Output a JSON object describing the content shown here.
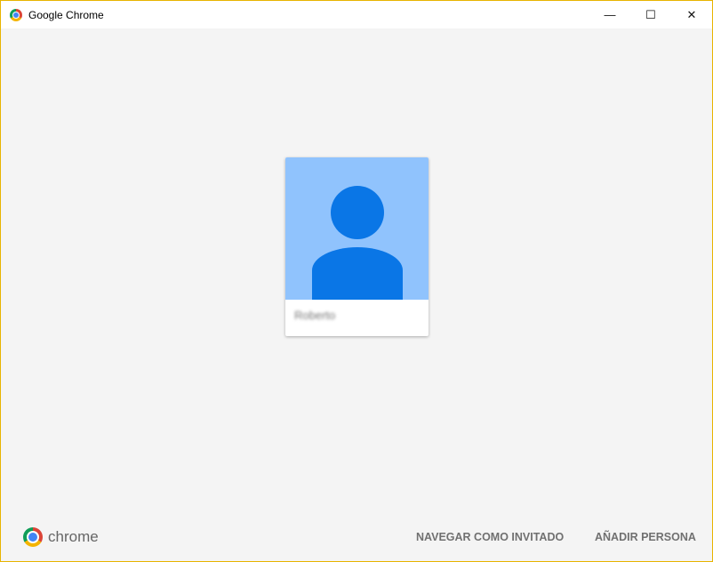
{
  "window": {
    "title": "Google Chrome",
    "minimize": "—",
    "maximize": "☐",
    "close": "✕"
  },
  "profile": {
    "name": "Roberto",
    "avatar_bg": "#90c3fd",
    "avatar_fg": "#0a76e6"
  },
  "footer": {
    "brand": "chrome",
    "guest_button": "NAVEGAR COMO INVITADO",
    "add_person_button": "AÑADIR PERSONA"
  }
}
